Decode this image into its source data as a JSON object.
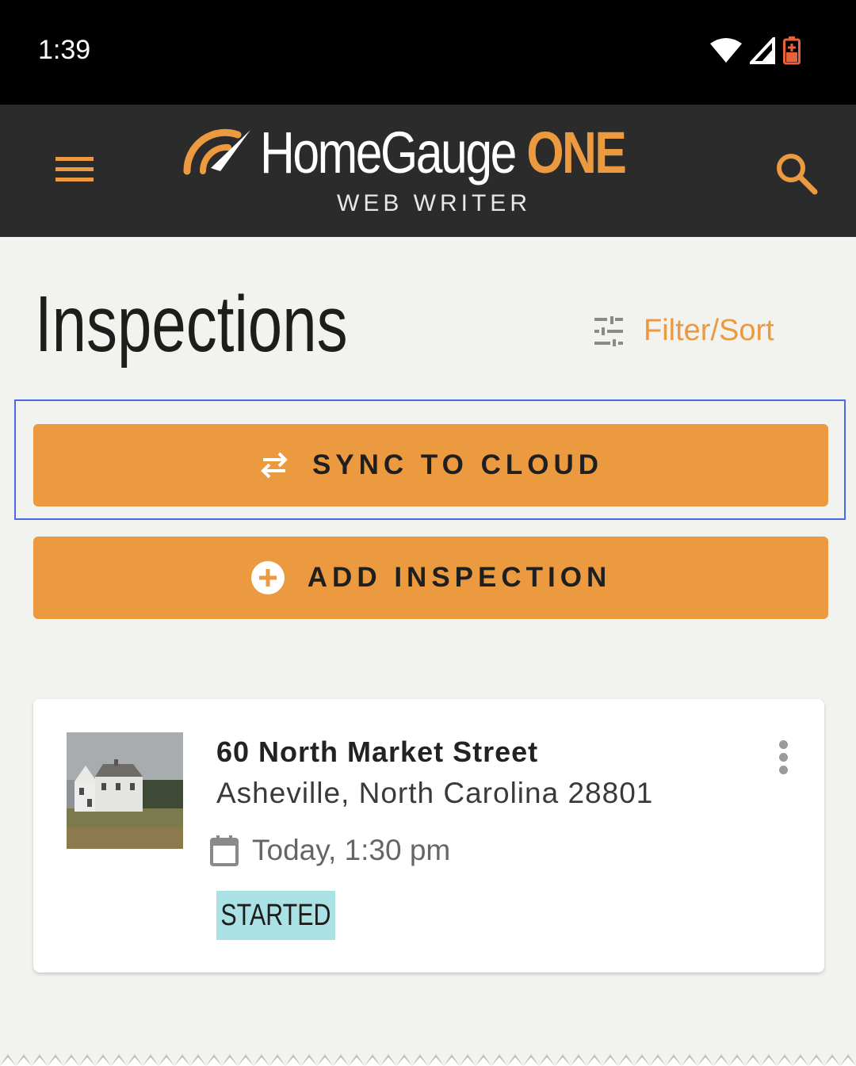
{
  "status_bar": {
    "time": "1:39"
  },
  "header": {
    "logo_name": "HomeGauge",
    "logo_accent": "ONE",
    "logo_subtitle": "WEB WRITER"
  },
  "page": {
    "title": "Inspections",
    "filter_label": "Filter/Sort"
  },
  "actions": {
    "sync_label": "SYNC TO CLOUD",
    "add_label": "ADD INSPECTION"
  },
  "inspection": {
    "address": "60 North Market Street",
    "city": "Asheville, North Carolina 28801",
    "date": "Today, 1:30 pm",
    "status": "STARTED"
  },
  "colors": {
    "accent": "#eb9a3f",
    "header_bg": "#2b2b2b",
    "page_bg": "#f2f2ee",
    "badge_bg": "#a9e1e4",
    "focus_ring": "#4a6ae8"
  }
}
